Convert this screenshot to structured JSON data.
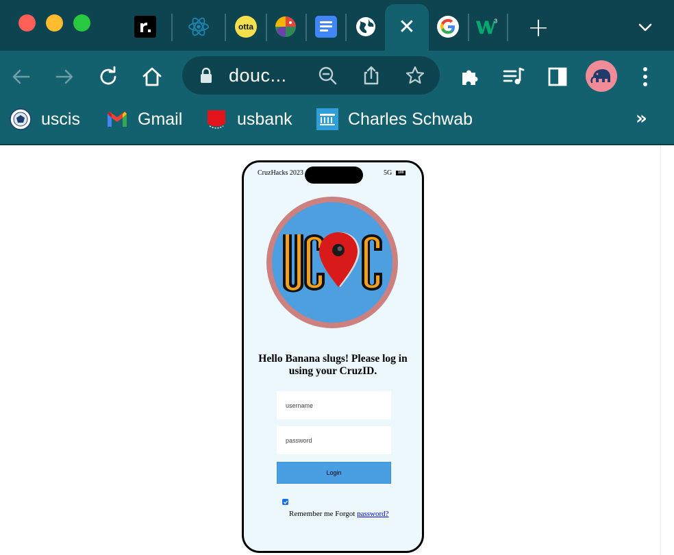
{
  "window": {
    "traffic_lights": [
      "close",
      "minimize",
      "maximize"
    ]
  },
  "tabs": [
    {
      "icon": "r-dot-icon"
    },
    {
      "icon": "react-icon"
    },
    {
      "icon": "otta-icon",
      "text": "otta"
    },
    {
      "icon": "colorful-logo-icon"
    },
    {
      "icon": "google-docs-icon"
    },
    {
      "icon": "globe-icon"
    },
    {
      "icon": "close-icon",
      "active": true
    },
    {
      "icon": "google-icon"
    },
    {
      "icon": "w3-icon"
    }
  ],
  "toolbar": {
    "url": "douc...",
    "buttons": [
      "back",
      "forward",
      "reload",
      "home",
      "extensions",
      "media-controls",
      "side-panel",
      "profile",
      "menu"
    ]
  },
  "bookmarks": [
    {
      "label": "uscis",
      "icon": "uscis-seal-icon"
    },
    {
      "label": "Gmail",
      "icon": "gmail-icon"
    },
    {
      "label": "usbank",
      "icon": "usbank-icon"
    },
    {
      "label": "Charles Schwab",
      "icon": "schwab-icon"
    }
  ],
  "bookmarks_more": "»",
  "phone": {
    "status_left": "CruzHacks 2023",
    "status_network": "5G",
    "battery": "100",
    "logo_text_left": "UC",
    "logo_text_right": "C",
    "heading": "Hello Banana slugs! Please log in using your CruzID.",
    "username_placeholder": "username",
    "password_placeholder": "password",
    "login_label": "Login",
    "remember_checked": true,
    "remember_text": "Remember me Forgot ",
    "forgot_link": "password?"
  },
  "colors": {
    "tabstrip": "#0e4450",
    "toolbar": "#13606f",
    "phone_bg": "#edf8fd",
    "login_button": "#4a9fe3",
    "logo_ring": "#cd8080",
    "logo_fill": "#4d9fe0"
  }
}
